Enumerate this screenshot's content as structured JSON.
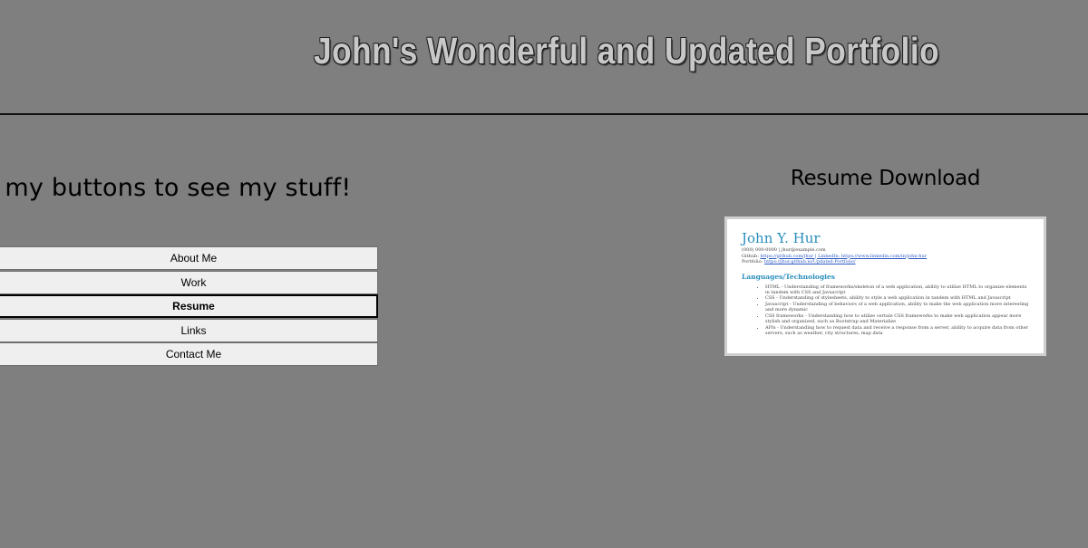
{
  "header": {
    "title": "John's Wonderful and Updated Portfolio"
  },
  "intro": {
    "text": "ick my buttons to see my stuff!"
  },
  "nav": {
    "buttons": [
      {
        "label": "About Me"
      },
      {
        "label": "Work"
      },
      {
        "label": "Resume"
      },
      {
        "label": "Links"
      },
      {
        "label": "Contact Me"
      }
    ],
    "active": "Resume"
  },
  "resume": {
    "heading": "Resume Download",
    "preview": {
      "name": "John Y. Hur",
      "contact_line": "(000) 000-0000 | jhur@example.com",
      "github_prefix": "Github:",
      "github": "https://github.com/jhur | LinkedIn: https://www.linkedin.com/in/john-hur",
      "portfolio_prefix": "Portfolio:",
      "portfolio": "https://jhur.github.io/Updated-Portfolio/",
      "section": "Languages/Technologies",
      "items": [
        "HTML - Understanding of frameworks/skeleton of a web application, ability to utilize HTML to organize elements in tandem with CSS and Javascript",
        "CSS - Understanding of stylesheets, ability to style a web application in tandem with HTML and Javascript",
        "Javascript - Understanding of behaviors of a web application, ability to make the web application more interesting and more dynamic",
        "CSS frameworks - Understanding how to utilize certain CSS frameworks to make web application appear more stylish and organized, such as Bootstrap and Materialize",
        "APIs - Understanding how to request data and receive a response from a server, ability to acquire data from other servers, such as weather, city structures, map data"
      ]
    }
  },
  "colors": {
    "background": "#7f7f7f",
    "title_fill": "#c8c8c8",
    "button_bg": "#efefef",
    "cv_accent": "#2a8fbd"
  }
}
